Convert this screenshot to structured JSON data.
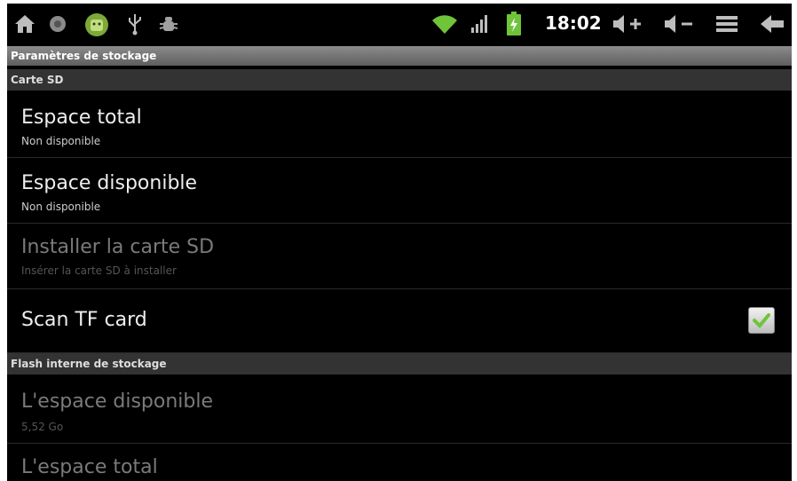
{
  "status_bar": {
    "time": "18:02",
    "icons": [
      "home-icon",
      "record-icon",
      "android-icon",
      "usb-icon",
      "debug-bug-icon",
      "wifi-icon",
      "signal-icon",
      "battery-charging-icon",
      "volume-up-icon",
      "volume-down-icon",
      "menu-icon",
      "back-icon"
    ],
    "accent_color": "#8cc63f"
  },
  "title": "Paramètres de stockage",
  "sections": [
    {
      "header": "Carte SD",
      "items": [
        {
          "title": "Espace total",
          "summary": "Non disponible",
          "enabled": true
        },
        {
          "title": "Espace disponible",
          "summary": "Non disponible",
          "enabled": true
        },
        {
          "title": "Installer la carte SD",
          "summary": "Insérer la carte SD à installer",
          "enabled": false
        },
        {
          "title": "Scan TF card",
          "checked": true,
          "enabled": true
        }
      ]
    },
    {
      "header": "Flash interne de stockage",
      "items": [
        {
          "title": "L'espace disponible",
          "summary": "5,52 Go",
          "enabled": false
        },
        {
          "title": "L'espace total",
          "enabled": false
        }
      ]
    }
  ]
}
